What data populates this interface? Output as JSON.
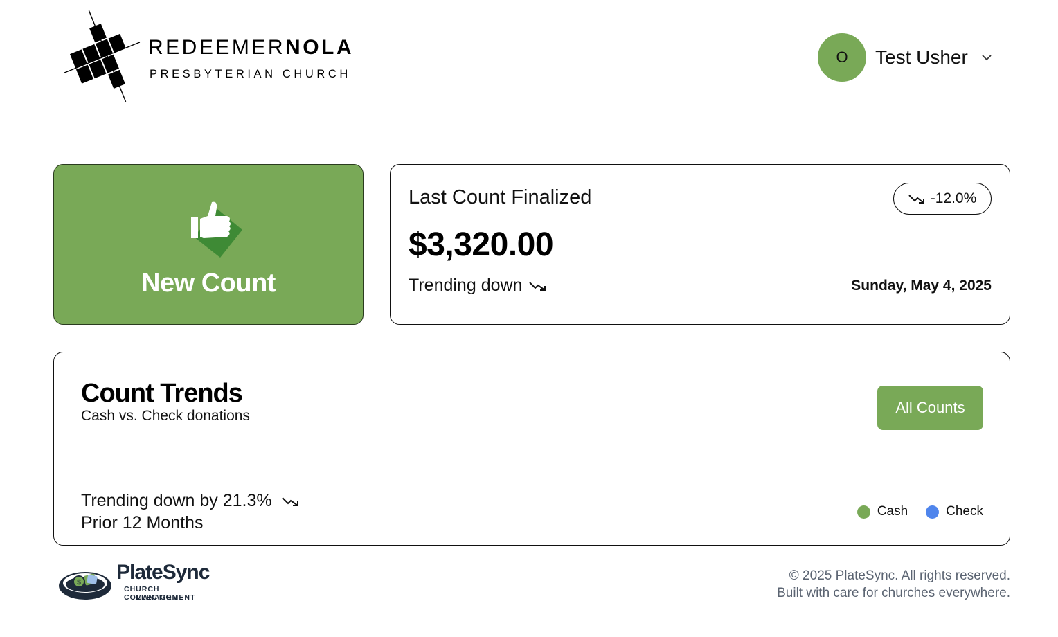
{
  "header": {
    "logo": {
      "name_light": "REDEEMER",
      "name_bold": "NOLA",
      "subtitle": "PRESBYTERIAN CHURCH"
    },
    "user": {
      "avatar_initial": "O",
      "name": "Test Usher",
      "menu_icon": "chevron-down-icon"
    }
  },
  "new_count_card": {
    "icon": "thumbs-up-icon",
    "label": "New Count"
  },
  "last_count_card": {
    "title": "Last Count Finalized",
    "amount": "$3,320.00",
    "change_badge": "-12.0%",
    "trend_label": "Trending down",
    "date": "Sunday, May 4, 2025",
    "trend_icon": "trending-down-icon"
  },
  "trends_card": {
    "title": "Count Trends",
    "subtitle": "Cash vs. Check donations",
    "button_label": "All Counts",
    "trend_label": "Trending down by 21.3%",
    "period": "Prior 12 Months",
    "legend": [
      {
        "label": "Cash",
        "color": "#79a957"
      },
      {
        "label": "Check",
        "color": "#4f85ec"
      }
    ]
  },
  "footer": {
    "brand": {
      "name": "PlateSync",
      "tagline_line1": "CHURCH COLLECTION",
      "tagline_line2": "MANAGEMENT"
    },
    "copyright": "© 2025 PlateSync. All rights reserved.",
    "tagline": "Built with care for churches everywhere."
  },
  "colors": {
    "brand_green": "#79a957",
    "check_blue": "#4f85ec",
    "muted_text": "#5b6472"
  }
}
